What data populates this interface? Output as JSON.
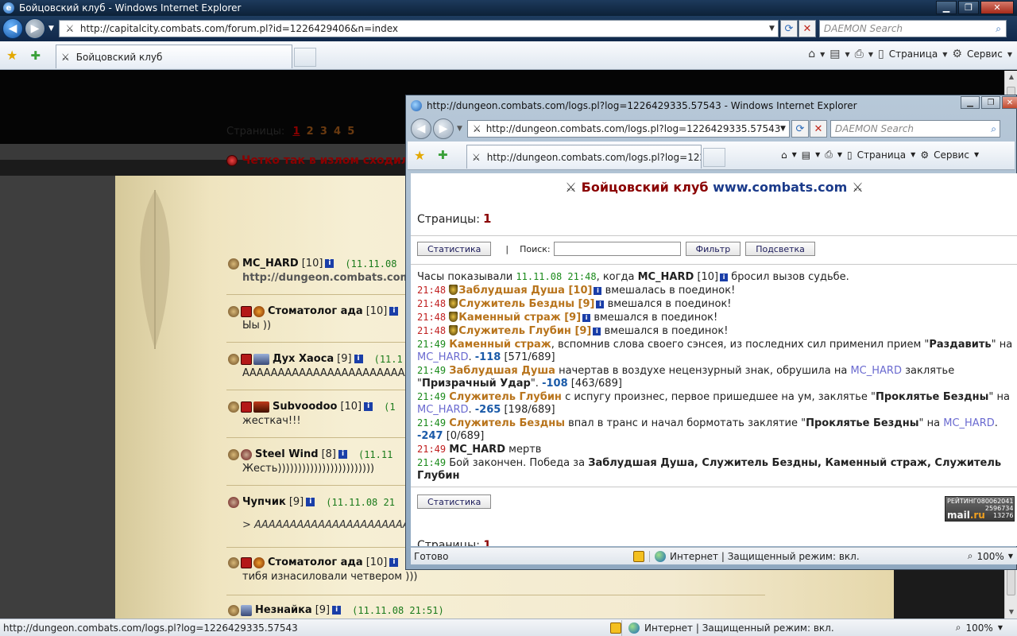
{
  "main_window": {
    "title": "Бойцовский клуб - Windows Internet Explorer",
    "address": "http://capitalcity.combats.com/forum.pl?id=1226429406&n=index",
    "search_placeholder": "DAEMON Search",
    "tab_label": "Бойцовский клуб",
    "tools": {
      "page": "Страница",
      "service": "Сервис"
    },
    "status_url": "http://dungeon.combats.com/logs.pl?log=1226429335.57543",
    "status_zone": "Интернет | Защищенный режим: вкл.",
    "zoom": "100%"
  },
  "forum": {
    "pages_label": "Страницы:",
    "pages": [
      "1",
      "2",
      "3",
      "4",
      "5"
    ],
    "topic_title": "Четко так в излом сходил!",
    "posts": [
      {
        "nick": "MC_HARD",
        "level": "[10]",
        "time": "(11.11.08",
        "body": "http://dungeon.combats.com"
      },
      {
        "nick": "Стоматолог ада",
        "level": "[10]",
        "time": "",
        "body": "Ыы ))"
      },
      {
        "nick": "Дух Хаоса",
        "level": "[9]",
        "time": "(11.1",
        "body": "АААААААААААААААААААААААА"
      },
      {
        "nick": "Subvoodoo",
        "level": "[10]",
        "time": "(1",
        "body": "жесткач!!!"
      },
      {
        "nick": "Steel Wind",
        "level": "[8]",
        "time": "(11.11",
        "body": "Жесть))))))))))))))))))))))))"
      },
      {
        "nick": "Чупчик",
        "level": "[9]",
        "time": "(11.11.08 21",
        "body": "> ААААААААААААААААААААААААА"
      },
      {
        "nick": "Стоматолог ада",
        "level": "[10]",
        "time": "",
        "body": "тибя изнасиловали четвером )))"
      },
      {
        "nick": "Незнайка",
        "level": "[9]",
        "time": "(11.11.08 21:51)",
        "body": ""
      }
    ]
  },
  "popup": {
    "title": "http://dungeon.combats.com/logs.pl?log=1226429335.57543 - Windows Internet Explorer",
    "address": "http://dungeon.combats.com/logs.pl?log=1226429335.57543",
    "search_placeholder": "DAEMON Search",
    "tab_label": "http://dungeon.combats.com/logs.pl?log=12264...",
    "tools": {
      "page": "Страница",
      "service": "Сервис"
    },
    "brand_club": "Бойцовский клуб",
    "brand_site": "www.combats.com",
    "pages_label": "Страницы:",
    "pages_current": "1",
    "stats_button": "Статистика",
    "pipe": "|",
    "search_label": "Поиск:",
    "filter_button": "Фильтр",
    "highlight_button": "Подсветка",
    "log": {
      "l1_a": "Часы показывали",
      "l1_time": "11.11.08 21:48",
      "l1_b": ", когда",
      "l1_nick": "MC_HARD",
      "l1_lvl": "[10]",
      "l1_c": "бросил вызов судьбе.",
      "t_2148": "21:48",
      "t_2149": "21:49",
      "bot1": "Заблудшая Душа [10]",
      "bot1_act": "вмешалась в поединок!",
      "bot2": "Служитель Бездны [9]",
      "bot2_act": "вмешался в поединок!",
      "bot3": "Каменный страж [9]",
      "bot3_act": "вмешался в поединок!",
      "bot4": "Служитель Глубин [9]",
      "bot4_act": "вмешался в поединок!",
      "e1_who": "Каменный страж",
      "e1_a": ", вспомнив слова своего сэнсея, из последних сил применил прием \"",
      "e1_skill": "Раздавить",
      "e1_b": "\"",
      "e1_on": "на",
      "e1_target": "MC_HARD",
      "e1_dmg": "-118",
      "e1_hp": "[571/689]",
      "e2_who": "Заблудшая Душа",
      "e2_a": "начертав в воздухе нецензурный знак, обрушила на",
      "e2_target": "MC_HARD",
      "e2_b": "заклятье \"",
      "e2_spell": "Призрачный Удар",
      "e2_c": "\".",
      "e2_dmg": "-108",
      "e2_hp": "[463/689]",
      "e3_who": "Служитель Глубин",
      "e3_a": "с испугу произнес, первое пришедшее на ум, заклятье \"",
      "e3_spell": "Проклятье Бездны",
      "e3_b": "\" на",
      "e3_target": "MC_HARD",
      "e3_dmg": "-265",
      "e3_hp": "[198/689]",
      "e4_who": "Служитель Бездны",
      "e4_a": "впал в транс и начал бормотать заклятие \"",
      "e4_spell": "Проклятье Бездны",
      "e4_b": "\" на",
      "e4_target": "MC_HARD",
      "e4_dmg": "-247",
      "e4_hp": "[0/689]",
      "dead_nick": "MC_HARD",
      "dead_text": "мертв",
      "end_a": "Бой закончен. Победа за",
      "end_winners": "Заблудшая Душа, Служитель Бездны, Каменный страж, Служитель Глубин"
    },
    "counter": {
      "label": "РЕЙТИНГ",
      "num1": "080062041",
      "brand": "mail",
      "brand_ru": ".ru",
      "num2": "2596734",
      "num3": "13276"
    },
    "status_text": "Готово",
    "status_zone": "Интернет | Защищенный режим: вкл.",
    "zoom": "100%"
  }
}
